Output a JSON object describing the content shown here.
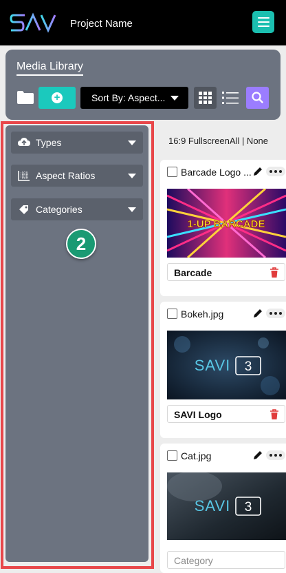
{
  "header": {
    "logo_text": "SAVI",
    "project_name": "Project Name",
    "menu_icon": "hamburger-icon"
  },
  "toolbar": {
    "title": "Media Library",
    "folder_icon": "folder-icon",
    "add_icon": "plus-circle-icon",
    "sort_label": "Sort By: Aspect...",
    "grid_icon": "grid-view-icon",
    "list_icon": "list-view-icon",
    "search_icon": "search-icon"
  },
  "filters": [
    {
      "label": "Types",
      "icon": "cloud-upload-icon"
    },
    {
      "label": "Aspect Ratios",
      "icon": "aspect-ratio-icon"
    },
    {
      "label": "Categories",
      "icon": "tag-icon"
    }
  ],
  "step_badge": "2",
  "filter_status": "16:9 FullscreenAll | None",
  "media": [
    {
      "name": "Barcade Logo ...",
      "label": "Barcade",
      "thumb_text": "1-UP BARCADE"
    },
    {
      "name": "Bokeh.jpg",
      "label": "SAVI Logo",
      "thumb_text": "SAVI 3"
    },
    {
      "name": "Cat.jpg",
      "label": "",
      "placeholder": "Category",
      "thumb_text": "SAVI 3"
    }
  ],
  "colors": {
    "accent_teal": "#1bc9bd",
    "search_purple": "#9b7dff",
    "panel_gray": "#6c7380",
    "highlight_red": "#e8474a",
    "badge_green": "#1a9a73",
    "trash_red": "#e03c3c"
  }
}
